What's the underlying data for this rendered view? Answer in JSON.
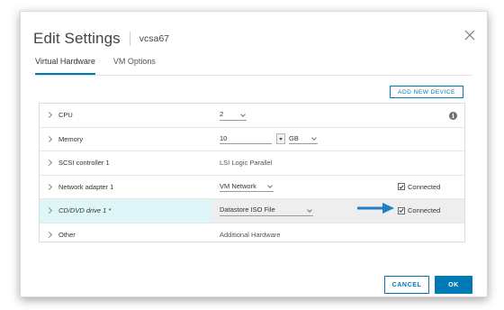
{
  "dialog": {
    "title": "Edit Settings",
    "subtitle": "vcsa67",
    "close_icon": "close-icon"
  },
  "tabs": [
    {
      "label": "Virtual Hardware",
      "active": true
    },
    {
      "label": "VM Options",
      "active": false
    }
  ],
  "add_device_label": "ADD NEW DEVICE",
  "hardware": {
    "cpu": {
      "label": "CPU",
      "value": "2",
      "info_icon": "info-icon"
    },
    "memory": {
      "label": "Memory",
      "value": "10",
      "unit": "GB"
    },
    "scsi": {
      "label": "SCSI controller 1",
      "value": "LSI Logic Parallel"
    },
    "network": {
      "label": "Network adapter 1",
      "value": "VM Network",
      "connected_label": "Connected",
      "connected": true
    },
    "cdrom": {
      "label": "CD/DVD drive 1 *",
      "value": "Datastore ISO File",
      "connected_label": "Connected",
      "connected": true
    },
    "other": {
      "label": "Other",
      "value": "Additional Hardware"
    }
  },
  "annotation": {
    "icon": "arrow-right-icon",
    "color": "#1f7fc4"
  },
  "footer": {
    "cancel_label": "CANCEL",
    "ok_label": "OK"
  },
  "colors": {
    "accent": "#0079b8",
    "highlight_row": "#dff6f8"
  }
}
